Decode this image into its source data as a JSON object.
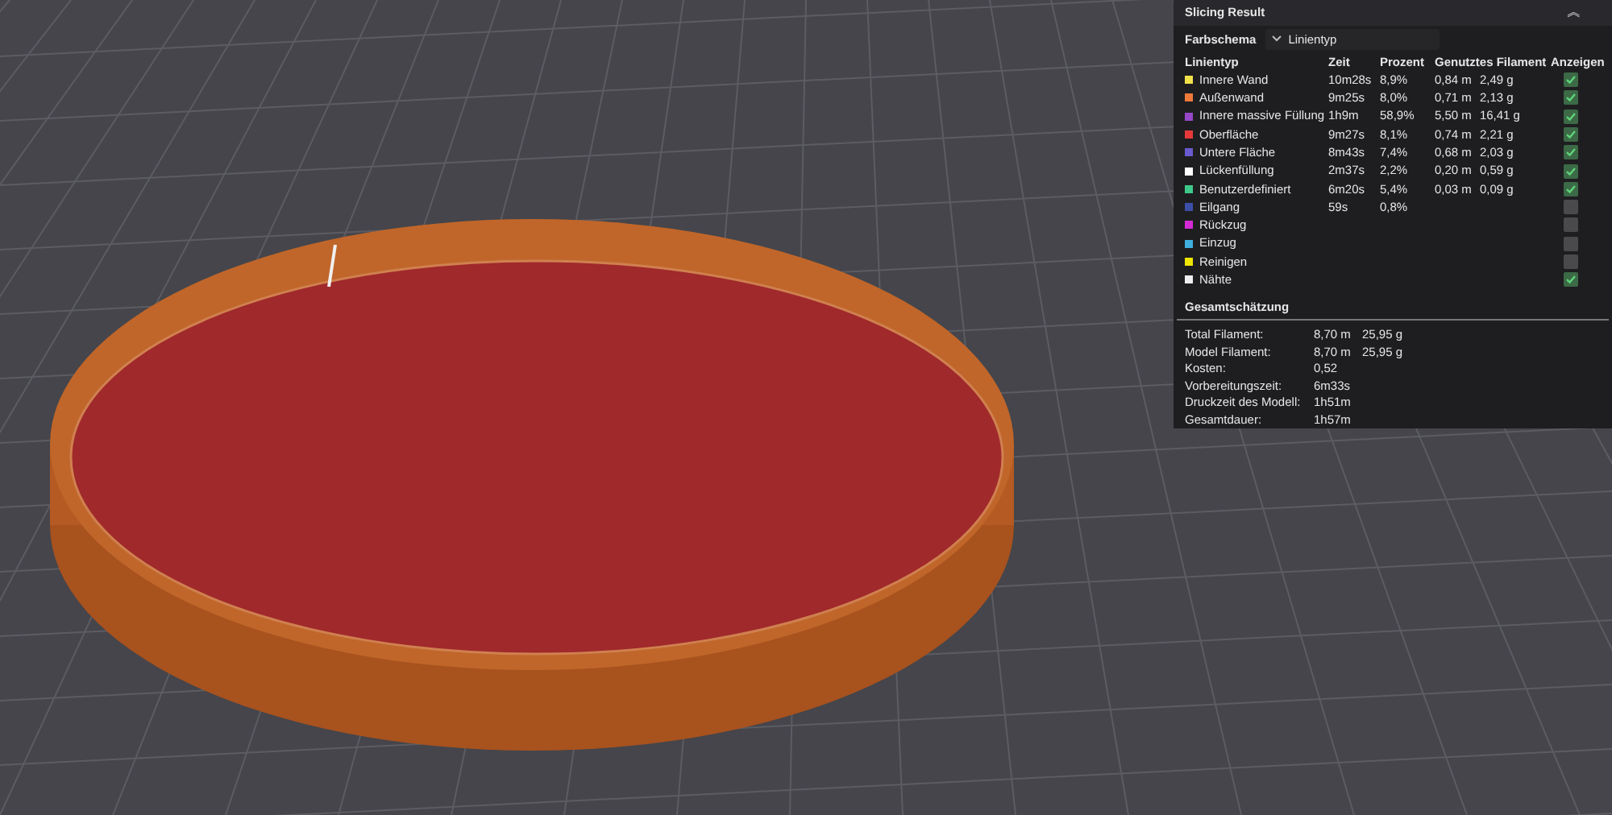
{
  "panel": {
    "title": "Slicing Result",
    "collapse_icon": "︽",
    "color_scheme_label": "Farbschema",
    "color_scheme_value": "Linientyp",
    "columns": [
      "Linientyp",
      "Zeit",
      "Prozent",
      "Genutztes Filament",
      "Anzeigen"
    ],
    "rows": [
      {
        "name": "Innere Wand",
        "color": "#f2e24a",
        "time": "10m28s",
        "percent": "8,9%",
        "length": "0,84 m",
        "weight": "2,49 g",
        "checked": true
      },
      {
        "name": "Außenwand",
        "color": "#f07a3a",
        "time": "9m25s",
        "percent": "8,0%",
        "length": "0,71 m",
        "weight": "2,13 g",
        "checked": true
      },
      {
        "name": "Innere massive Füllung",
        "color": "#9648c8",
        "time": "1h9m",
        "percent": "58,9%",
        "length": "5,50 m",
        "weight": "16,41 g",
        "checked": true
      },
      {
        "name": "Oberfläche",
        "color": "#e8393a",
        "time": "9m27s",
        "percent": "8,1%",
        "length": "0,74 m",
        "weight": "2,21 g",
        "checked": true
      },
      {
        "name": "Untere Fläche",
        "color": "#6a5acd",
        "time": "8m43s",
        "percent": "7,4%",
        "length": "0,68 m",
        "weight": "2,03 g",
        "checked": true
      },
      {
        "name": "Lückenfüllung",
        "color": "#ffffff",
        "time": "2m37s",
        "percent": "2,2%",
        "length": "0,20 m",
        "weight": "0,59 g",
        "checked": true
      },
      {
        "name": "Benutzerdefiniert",
        "color": "#3ec98a",
        "time": "6m20s",
        "percent": "5,4%",
        "length": "0,03 m",
        "weight": "0,09 g",
        "checked": true
      },
      {
        "name": "Eilgang",
        "color": "#3c4fa8",
        "time": "59s",
        "percent": "0,8%",
        "checked": false
      },
      {
        "name": "Rückzug",
        "color": "#d42bd4",
        "checked": false
      },
      {
        "name": "Einzug",
        "color": "#3fb0e0",
        "checked": false
      },
      {
        "name": "Reinigen",
        "color": "#f0e600",
        "checked": false
      },
      {
        "name": "Nähte",
        "color": "#eeeeee",
        "checked": true
      }
    ],
    "summary_title": "Gesamtschätzung",
    "summary": [
      {
        "label": "Total Filament:",
        "value": "8,70 m",
        "value_2": "25,95 g"
      },
      {
        "label": "Model Filament:",
        "value": "8,70 m",
        "value_2": "25,95 g"
      },
      {
        "label": "Kosten:",
        "value": "0,52"
      },
      {
        "label": "Vorbereitungszeit:",
        "value": "6m33s"
      },
      {
        "label": "Druckzeit des Modell:",
        "value": "1h51m"
      },
      {
        "label": "Gesamtdauer:",
        "value": "1h57m"
      }
    ]
  }
}
